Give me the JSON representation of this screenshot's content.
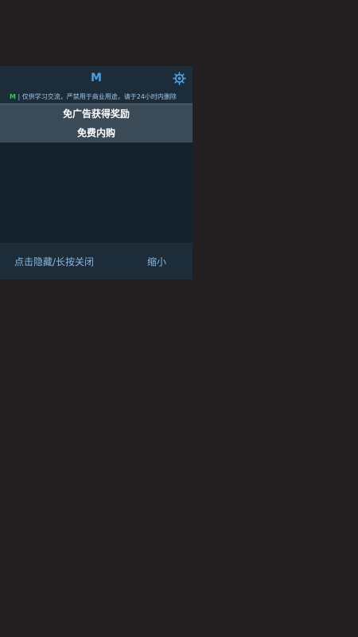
{
  "header": {
    "logo": "M",
    "settings_icon": "gear-icon"
  },
  "notice": {
    "tag": "M",
    "separator": " | ",
    "text": "仅供学习交流，严禁用于商业用途，请于24小时内删除"
  },
  "menu": {
    "items": [
      {
        "label": "免广告获得奖励"
      },
      {
        "label": "免费内购"
      }
    ]
  },
  "footer": {
    "hide_label": "点击隐藏/长按关闭",
    "minimize_label": "缩小"
  },
  "colors": {
    "background": "#231f20",
    "panel": "#15212a",
    "header": "#1c2c38",
    "accent": "#4aa0e6",
    "tag": "#2bd24a",
    "button": "#3a4a57"
  }
}
